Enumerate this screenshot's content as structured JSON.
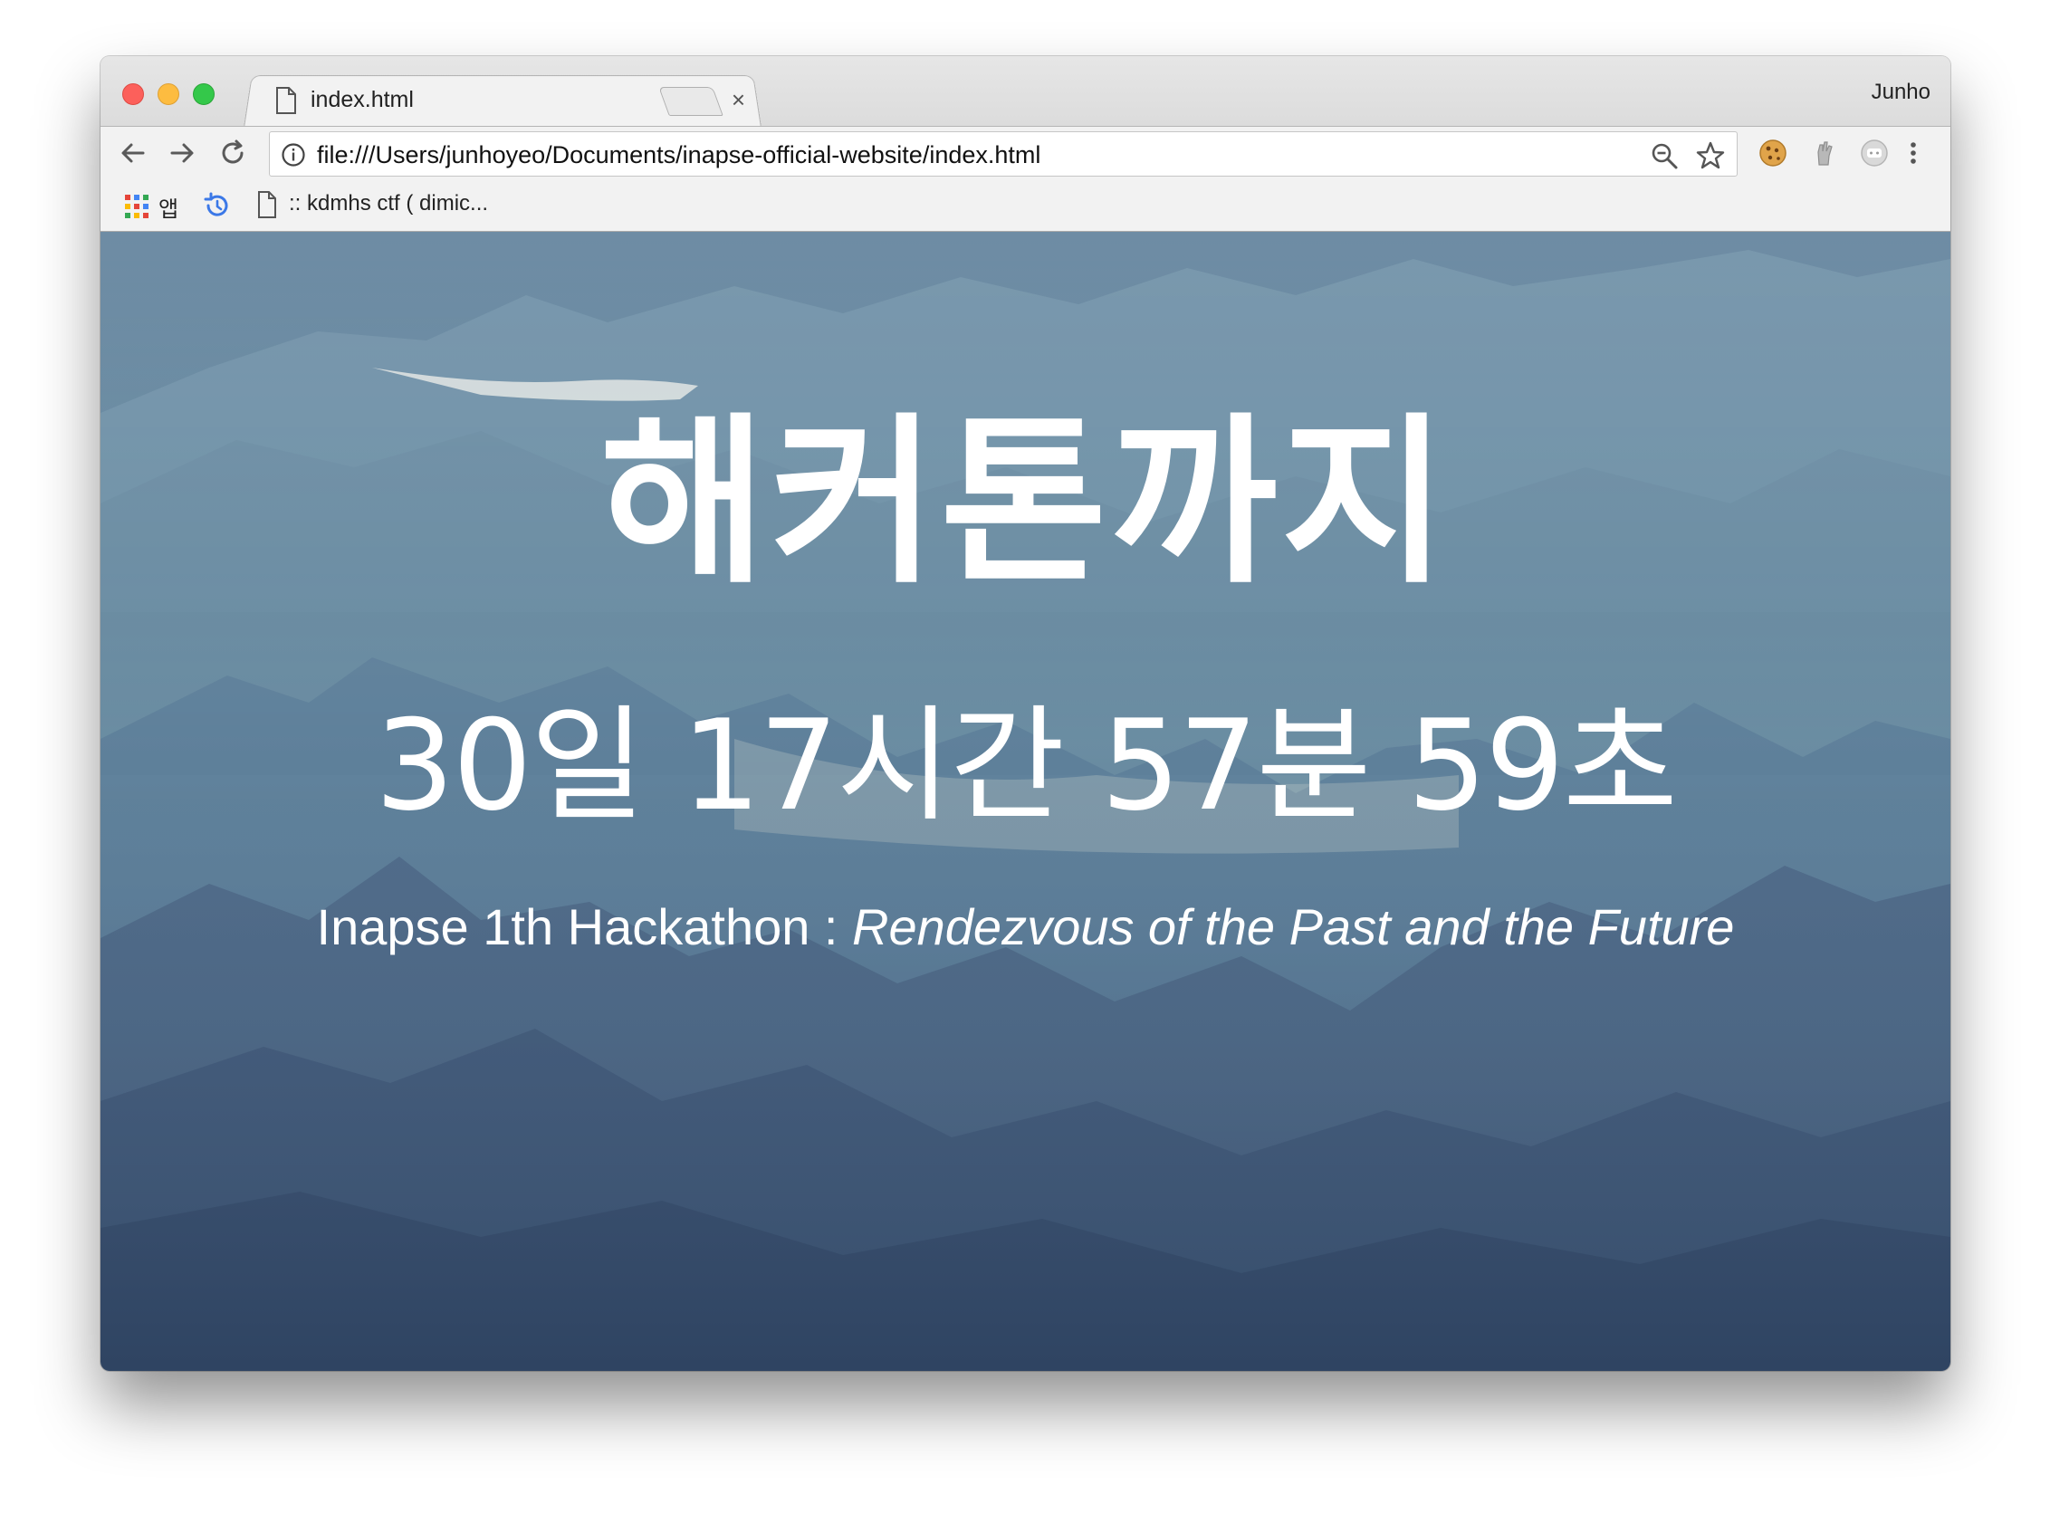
{
  "browser": {
    "tab_title": "index.html",
    "tab_close": "×",
    "profile_name": "Junho",
    "url": "file:///Users/junhoyeo/Documents/inapse-official-website/index.html"
  },
  "bookmarks": {
    "apps_label": "앱",
    "items": [
      {
        "label": ":: kdmhs ctf ( dimic..."
      }
    ]
  },
  "page": {
    "headline": "해커톤까지",
    "countdown": "30일 17시간 57분 59초",
    "tagline_prefix": "Inapse 1th Hackathon : ",
    "tagline_emphasis": "Rendezvous of the Past and the Future"
  },
  "icons": {
    "back": "back-arrow-icon",
    "forward": "forward-arrow-icon",
    "reload": "reload-icon",
    "info": "info-icon",
    "zoom": "zoom-out-icon",
    "star": "bookmark-star-icon",
    "apps": "apps-grid-icon",
    "history": "history-icon"
  },
  "colors": {
    "traffic_red": "#fc605b",
    "traffic_yellow": "#fdbc40",
    "traffic_green": "#34c84a",
    "text_on_hero": "#ffffff"
  }
}
